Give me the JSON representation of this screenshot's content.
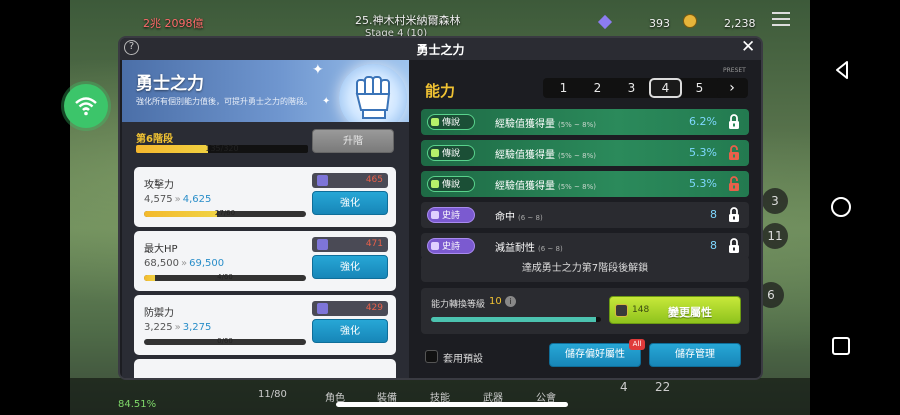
{
  "hud": {
    "power_text": "2兆 2098億",
    "map_name": "25.神木村米納爾森林",
    "stage_text": "Stage 4 (10)",
    "gem_count": "393",
    "gold_count": "2,238"
  },
  "side_numbers": [
    "3",
    "11",
    "6"
  ],
  "bottom": {
    "percent": "84.51%",
    "slot_count": "11/80",
    "labels": [
      "角色",
      "裝備",
      "技能",
      "武器",
      "公會"
    ],
    "counts": [
      "4",
      "22"
    ]
  },
  "modal": {
    "title": "勇士之力",
    "help_label": "?",
    "close_label": "✕"
  },
  "hero": {
    "title": "勇士之力",
    "description": "強化所有個別能力值後，可提升勇士之力的階段。",
    "stage_label": "第6階段",
    "progress_text": "135/320",
    "progress_fraction": 0.42,
    "upgrade_label": "升階"
  },
  "stats": [
    {
      "name": "攻擊力",
      "current": "4,575",
      "next": "4,625",
      "progress_text": "27/60",
      "progress_fraction": 0.45,
      "cost": "465",
      "button": "強化"
    },
    {
      "name": "最大HP",
      "current": "68,500",
      "next": "69,500",
      "progress_text": "4/60",
      "progress_fraction": 0.07,
      "cost": "471",
      "button": "強化"
    },
    {
      "name": "防禦力",
      "current": "3,225",
      "next": "3,275",
      "progress_text": "0/60",
      "progress_fraction": 0.0,
      "cost": "429",
      "button": "強化"
    }
  ],
  "ability": {
    "title": "能力",
    "preset_label": "PRESET",
    "preset_tabs": [
      "1",
      "2",
      "3",
      "4",
      "5"
    ],
    "active_tab": "4",
    "next_label": "›",
    "rows": [
      {
        "grade": "傳說",
        "name": "經驗值獲得量",
        "range": "(5% ~ 8%)",
        "value": "6.2%",
        "locked": true
      },
      {
        "grade": "傳說",
        "name": "經驗值獲得量",
        "range": "(5% ~ 8%)",
        "value": "5.3%",
        "locked": false
      },
      {
        "grade": "傳說",
        "name": "經驗值獲得量",
        "range": "(5% ~ 8%)",
        "value": "5.3%",
        "locked": false
      },
      {
        "grade": "史詩",
        "name": "命中",
        "range": "(6 ~ 8)",
        "value": "8",
        "locked": true
      },
      {
        "grade": "史詩",
        "name": "減益耐性",
        "range": "(6 ~ 8)",
        "value": "8",
        "locked": true
      }
    ],
    "unlock_note": "達成勇士之力第7階段後解鎖",
    "convert_label": "能力轉換等級",
    "convert_level": "10",
    "convert_fraction": 0.97,
    "info_label": "i",
    "change_cost": "148",
    "change_label": "變更屬性",
    "preset_checkbox_label": "套用預設",
    "save_pref_label": "儲存偏好屬性",
    "all_badge": "All",
    "save_manage_label": "儲存管理"
  },
  "colors": {
    "legend_row": "#2b8a5b",
    "epic_badge": "#7b5ad0",
    "accent_yellow": "#f0c233",
    "blue_button": "#1786b8",
    "lock_open_red": "#e8604a"
  }
}
